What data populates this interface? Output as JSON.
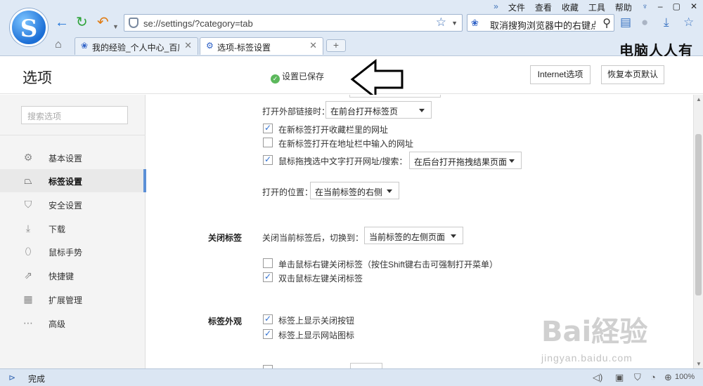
{
  "browser": {
    "menu": [
      "文件",
      "查看",
      "收藏",
      "工具",
      "帮助"
    ],
    "address": "se://settings/?category=tab",
    "search_text": "取消搜狗浏览器中的右键点",
    "tabs": [
      {
        "label": "我的经验_个人中心_百度"
      },
      {
        "label": "选项-标签设置"
      }
    ],
    "overlay_caption": "电脑人人有"
  },
  "header": {
    "title": "选项",
    "saved_status": "设置已保存",
    "internet_button": "Internet选项",
    "reset_button": "恢复本页默认"
  },
  "sidebar": {
    "search_placeholder": "搜索选项",
    "items": [
      {
        "label": "基本设置",
        "icon": "gear-icon"
      },
      {
        "label": "标签设置",
        "icon": "tab-icon",
        "active": true
      },
      {
        "label": "安全设置",
        "icon": "shield-icon"
      },
      {
        "label": "下载",
        "icon": "download-icon"
      },
      {
        "label": "鼠标手势",
        "icon": "mouse-icon"
      },
      {
        "label": "快捷键",
        "icon": "shortcut-icon"
      },
      {
        "label": "扩展管理",
        "icon": "extensions-icon"
      },
      {
        "label": "高级",
        "icon": "more-icon"
      }
    ]
  },
  "main": {
    "open_external": {
      "label": "打开外部链接时：",
      "value": "在前台打开标签页"
    },
    "cb_favorites": {
      "label": "在新标签打开收藏栏里的网址",
      "checked": true
    },
    "cb_address": {
      "label": "在新标签打开在地址栏中输入的网址",
      "checked": false
    },
    "cb_drag": {
      "label": "鼠标拖拽选中文字打开网址/搜索：",
      "checked": true
    },
    "drag_select": "在后台打开拖拽结果页面",
    "open_position": {
      "label": "打开的位置：",
      "value": "在当前标签的右侧"
    },
    "close_section": {
      "title": "关闭标签",
      "after_close_label": "关闭当前标签后，切换到：",
      "after_close_value": "当前标签的左侧页面",
      "cb_right_click": {
        "label": "单击鼠标右键关闭标签（按住Shift键右击可强制打开菜单）",
        "checked": false
      },
      "cb_double_click": {
        "label": "双击鼠标左键关闭标签",
        "checked": true
      }
    },
    "appearance_section": {
      "title": "标签外观",
      "cb_close_button": {
        "label": "标签上显示关闭按钮",
        "checked": true
      },
      "cb_site_icon": {
        "label": "标签上显示网站图标",
        "checked": true
      }
    }
  },
  "statusbar": {
    "text": "完成",
    "zoom": "100%"
  },
  "watermark": {
    "brand": "Bai経验",
    "url": "jingyan.baidu.com"
  },
  "colors": {
    "accent": "#5b8fd6",
    "check": "#2f6fd0",
    "saved_green": "#5cb85c"
  }
}
